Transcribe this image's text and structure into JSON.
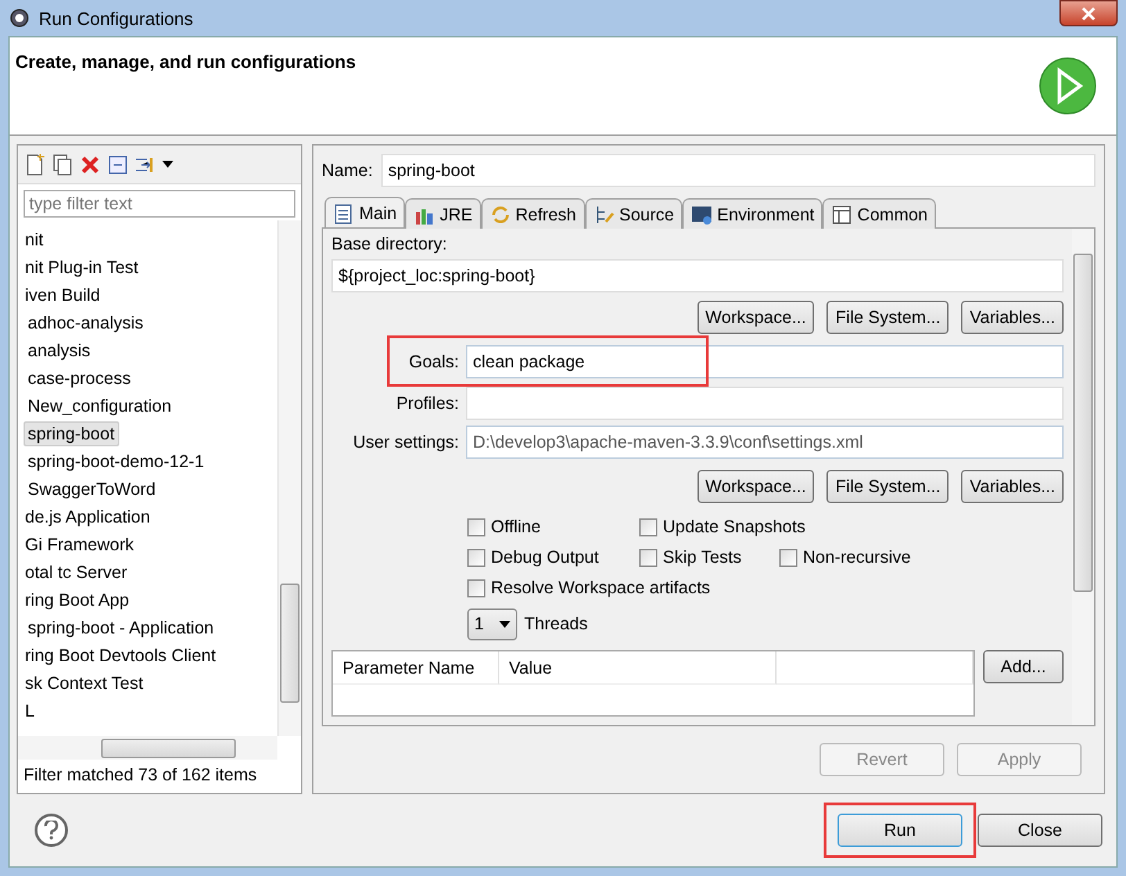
{
  "window": {
    "title": "Run Configurations"
  },
  "header": {
    "title": "Create, manage, and run configurations"
  },
  "sidebar": {
    "filter": {
      "placeholder": "type filter text"
    },
    "items": [
      {
        "label": "nit",
        "selected": false
      },
      {
        "label": "nit Plug-in Test",
        "selected": false
      },
      {
        "label": "iven Build",
        "selected": false,
        "children": [
          {
            "label": "adhoc-analysis",
            "selected": false
          },
          {
            "label": "analysis",
            "selected": false
          },
          {
            "label": "case-process",
            "selected": false
          },
          {
            "label": "New_configuration",
            "selected": false
          },
          {
            "label": "spring-boot",
            "selected": true
          },
          {
            "label": "spring-boot-demo-12-1",
            "selected": false
          },
          {
            "label": "SwaggerToWord",
            "selected": false
          }
        ]
      },
      {
        "label": "de.js Application",
        "selected": false
      },
      {
        "label": "Gi Framework",
        "selected": false
      },
      {
        "label": "otal tc Server",
        "selected": false
      },
      {
        "label": "ring Boot App",
        "selected": false,
        "children": [
          {
            "label": "spring-boot - Application",
            "selected": false
          }
        ]
      },
      {
        "label": "ring Boot Devtools Client",
        "selected": false
      },
      {
        "label": "sk Context Test",
        "selected": false
      },
      {
        "label": "L",
        "selected": false
      }
    ],
    "status": "Filter matched 73 of 162 items"
  },
  "name": {
    "label": "Name:",
    "value": "spring-boot"
  },
  "tabs": [
    {
      "label": "Main",
      "selected": true,
      "kind": "main"
    },
    {
      "label": "JRE",
      "selected": false,
      "kind": "jre"
    },
    {
      "label": "Refresh",
      "selected": false,
      "kind": "refresh"
    },
    {
      "label": "Source",
      "selected": false,
      "kind": "source"
    },
    {
      "label": "Environment",
      "selected": false,
      "kind": "environment"
    },
    {
      "label": "Common",
      "selected": false,
      "kind": "common"
    }
  ],
  "main": {
    "base_directory": {
      "label": "Base directory:",
      "value": "${project_loc:spring-boot}"
    },
    "buttons_1": [
      "Workspace...",
      "File System...",
      "Variables..."
    ],
    "goals": {
      "label": "Goals:",
      "value": "clean package",
      "highlighted": true
    },
    "profiles": {
      "label": "Profiles:"
    },
    "user_settings": {
      "label": "User settings:",
      "value": "D:\\develop3\\apache-maven-3.3.9\\conf\\settings.xml"
    },
    "buttons_2": [
      "Workspace...",
      "File System...",
      "Variables..."
    ],
    "options": [
      [
        {
          "label": "Offline",
          "checked": false
        },
        {
          "label": "Update Snapshots",
          "checked": false
        }
      ],
      [
        {
          "label": "Debug Output",
          "checked": false
        },
        {
          "label": "Skip Tests",
          "checked": false
        },
        {
          "label": "Non-recursive",
          "checked": false
        }
      ],
      [
        {
          "label": "Resolve Workspace artifacts",
          "checked": false
        }
      ]
    ],
    "threads": {
      "value": "1",
      "label": "Threads"
    },
    "table": {
      "columns": [
        "Parameter Name",
        "Value",
        ""
      ],
      "add_button": "Add..."
    }
  },
  "actions": [
    {
      "label": "Revert",
      "disabled": true
    },
    {
      "label": "Apply",
      "disabled": true
    }
  ],
  "footer": [
    {
      "label": "Run",
      "default": true,
      "highlighted": true
    },
    {
      "label": "Close",
      "default": false,
      "highlighted": false
    }
  ]
}
